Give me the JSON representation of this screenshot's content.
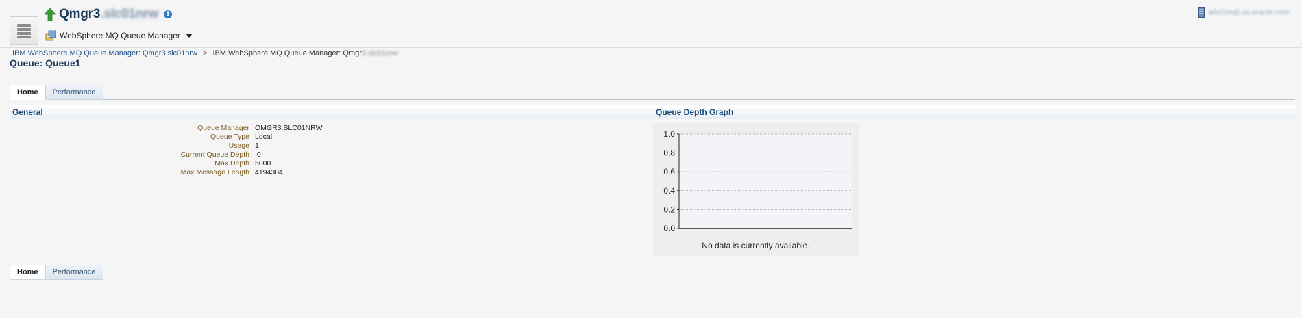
{
  "header": {
    "target_name_visible": "Qmgr3",
    "target_name_obscured": ".slc01nrw",
    "target_menu_label": "WebSphere MQ Queue Manager",
    "user_text_obscured": "wlsl1mqt.us.oracle.com",
    "info_glyph": "i"
  },
  "breadcrumb": {
    "link": "IBM WebSphere MQ Queue Manager: Qmgr3.slc01nrw",
    "separator": ">",
    "current_visible": "IBM WebSphere MQ Queue Manager: Qmgr",
    "current_obscured": "3.slc01nrw"
  },
  "page_title": "Queue: Queue1",
  "tabs": [
    {
      "label": "Home",
      "active": true
    },
    {
      "label": "Performance",
      "active": false
    }
  ],
  "general": {
    "title": "General",
    "properties": [
      {
        "label": "Queue Manager",
        "value": "QMGR3.SLC01NRW",
        "link": true
      },
      {
        "label": "Queue Type",
        "value": "Local",
        "link": false
      },
      {
        "label": "Usage",
        "value": "1",
        "link": false
      },
      {
        "label": "Current Queue Depth",
        "value": " 0",
        "link": false
      },
      {
        "label": "Max Depth",
        "value": "5000",
        "link": false
      },
      {
        "label": "Max Message Length",
        "value": "4194304",
        "link": false
      }
    ]
  },
  "graph": {
    "title": "Queue Depth Graph",
    "no_data_message": "No data is currently available."
  },
  "chart_data": {
    "type": "line",
    "title": "",
    "xlabel": "",
    "ylabel": "",
    "ylim": [
      0.0,
      1.0
    ],
    "yticks": [
      "1.0",
      "0.8",
      "0.6",
      "0.4",
      "0.2",
      "0.0"
    ],
    "series": [],
    "grid": true
  },
  "colors": {
    "title": "#1a3a5a",
    "link": "#1f4f8c",
    "label": "#7a5a1e",
    "up_status": "#3a9a3a",
    "info": "#2a7cc7"
  },
  "icons": {
    "status": "up-arrow-icon",
    "info": "info-icon",
    "nav": "hamburger-menu-icon",
    "target": "mq-queue-manager-icon",
    "dropdown": "caret-down-icon",
    "user": "server-icon"
  }
}
